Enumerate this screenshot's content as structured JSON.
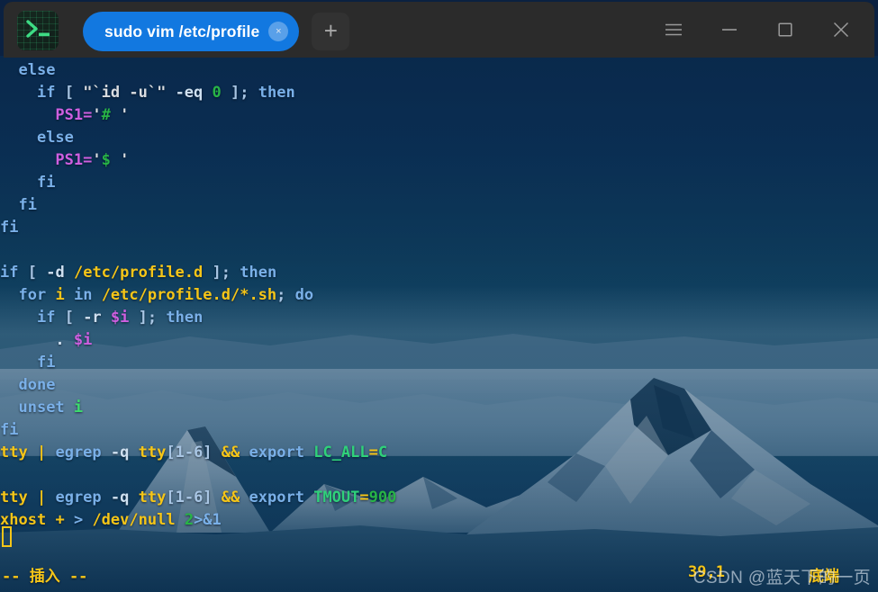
{
  "window": {
    "app_icon_name": "terminal-prompt-icon",
    "tabs": [
      {
        "label": "sudo vim /etc/profile",
        "close_label": "×",
        "active": true
      }
    ],
    "new_tab_label": "+",
    "controls": {
      "menu_name": "hamburger-menu",
      "minimize_name": "minimize",
      "maximize_name": "maximize",
      "close_name": "close"
    },
    "accent_color": "#1278e0",
    "titlebar_color": "#2b2b2b"
  },
  "editor": {
    "lines": [
      [
        {
          "t": "  ",
          "c": "plain"
        },
        {
          "t": "else",
          "c": "kw"
        }
      ],
      [
        {
          "t": "    ",
          "c": "plain"
        },
        {
          "t": "if",
          "c": "kw"
        },
        {
          "t": " ",
          "c": "plain"
        },
        {
          "t": "[",
          "c": "punc"
        },
        {
          "t": " ",
          "c": "plain"
        },
        {
          "t": "\"`id -u`\"",
          "c": "str"
        },
        {
          "t": " ",
          "c": "plain"
        },
        {
          "t": "-eq",
          "c": "plain"
        },
        {
          "t": " ",
          "c": "plain"
        },
        {
          "t": "0",
          "c": "num"
        },
        {
          "t": " ",
          "c": "plain"
        },
        {
          "t": "]",
          "c": "punc"
        },
        {
          "t": ";",
          "c": "punc"
        },
        {
          "t": " ",
          "c": "plain"
        },
        {
          "t": "then",
          "c": "kw"
        }
      ],
      [
        {
          "t": "      ",
          "c": "plain"
        },
        {
          "t": "PS1=",
          "c": "var"
        },
        {
          "t": "'",
          "c": "str"
        },
        {
          "t": "#",
          "c": "num"
        },
        {
          "t": " '",
          "c": "str"
        }
      ],
      [
        {
          "t": "    ",
          "c": "plain"
        },
        {
          "t": "else",
          "c": "kw"
        }
      ],
      [
        {
          "t": "      ",
          "c": "plain"
        },
        {
          "t": "PS1=",
          "c": "var"
        },
        {
          "t": "'",
          "c": "str"
        },
        {
          "t": "$",
          "c": "num"
        },
        {
          "t": " '",
          "c": "str"
        }
      ],
      [
        {
          "t": "    ",
          "c": "plain"
        },
        {
          "t": "fi",
          "c": "kw"
        }
      ],
      [
        {
          "t": "  ",
          "c": "plain"
        },
        {
          "t": "fi",
          "c": "kw"
        }
      ],
      [
        {
          "t": "fi",
          "c": "kw"
        }
      ],
      [
        {
          "t": "",
          "c": "plain"
        }
      ],
      [
        {
          "t": "if",
          "c": "kw"
        },
        {
          "t": " ",
          "c": "plain"
        },
        {
          "t": "[",
          "c": "punc"
        },
        {
          "t": " ",
          "c": "plain"
        },
        {
          "t": "-d",
          "c": "plain"
        },
        {
          "t": " ",
          "c": "plain"
        },
        {
          "t": "/etc/profile.d",
          "c": "path"
        },
        {
          "t": " ",
          "c": "plain"
        },
        {
          "t": "]",
          "c": "punc"
        },
        {
          "t": ";",
          "c": "punc"
        },
        {
          "t": " ",
          "c": "plain"
        },
        {
          "t": "then",
          "c": "kw"
        }
      ],
      [
        {
          "t": "  ",
          "c": "plain"
        },
        {
          "t": "for",
          "c": "kw"
        },
        {
          "t": " ",
          "c": "plain"
        },
        {
          "t": "i",
          "c": "path"
        },
        {
          "t": " ",
          "c": "plain"
        },
        {
          "t": "in",
          "c": "kw"
        },
        {
          "t": " ",
          "c": "plain"
        },
        {
          "t": "/etc/profile.d/*.sh",
          "c": "path"
        },
        {
          "t": ";",
          "c": "punc"
        },
        {
          "t": " ",
          "c": "plain"
        },
        {
          "t": "do",
          "c": "kw"
        }
      ],
      [
        {
          "t": "    ",
          "c": "plain"
        },
        {
          "t": "if",
          "c": "kw"
        },
        {
          "t": " ",
          "c": "plain"
        },
        {
          "t": "[",
          "c": "punc"
        },
        {
          "t": " ",
          "c": "plain"
        },
        {
          "t": "-r",
          "c": "plain"
        },
        {
          "t": " ",
          "c": "plain"
        },
        {
          "t": "$i",
          "c": "var"
        },
        {
          "t": " ",
          "c": "plain"
        },
        {
          "t": "]",
          "c": "punc"
        },
        {
          "t": ";",
          "c": "punc"
        },
        {
          "t": " ",
          "c": "plain"
        },
        {
          "t": "then",
          "c": "kw"
        }
      ],
      [
        {
          "t": "      ",
          "c": "plain"
        },
        {
          "t": ".",
          "c": "plain"
        },
        {
          "t": " ",
          "c": "plain"
        },
        {
          "t": "$i",
          "c": "var"
        }
      ],
      [
        {
          "t": "    ",
          "c": "plain"
        },
        {
          "t": "fi",
          "c": "kw"
        }
      ],
      [
        {
          "t": "  ",
          "c": "plain"
        },
        {
          "t": "done",
          "c": "kw"
        }
      ],
      [
        {
          "t": "  ",
          "c": "plain"
        },
        {
          "t": "unset",
          "c": "kw"
        },
        {
          "t": " ",
          "c": "plain"
        },
        {
          "t": "i",
          "c": "ident"
        }
      ],
      [
        {
          "t": "fi",
          "c": "kw"
        }
      ],
      [
        {
          "t": "tty",
          "c": "path"
        },
        {
          "t": " ",
          "c": "plain"
        },
        {
          "t": "|",
          "c": "path"
        },
        {
          "t": " ",
          "c": "plain"
        },
        {
          "t": "egrep",
          "c": "kw"
        },
        {
          "t": " ",
          "c": "plain"
        },
        {
          "t": "-q",
          "c": "plain"
        },
        {
          "t": " ",
          "c": "plain"
        },
        {
          "t": "tty",
          "c": "path"
        },
        {
          "t": "[1-6]",
          "c": "punc"
        },
        {
          "t": " ",
          "c": "plain"
        },
        {
          "t": "&&",
          "c": "path"
        },
        {
          "t": " ",
          "c": "plain"
        },
        {
          "t": "export",
          "c": "kw"
        },
        {
          "t": " ",
          "c": "plain"
        },
        {
          "t": "LC_ALL",
          "c": "envg"
        },
        {
          "t": "=",
          "c": "path"
        },
        {
          "t": "C",
          "c": "envg"
        }
      ],
      [
        {
          "t": "",
          "c": "plain"
        }
      ],
      [
        {
          "t": "tty",
          "c": "path"
        },
        {
          "t": " ",
          "c": "plain"
        },
        {
          "t": "|",
          "c": "path"
        },
        {
          "t": " ",
          "c": "plain"
        },
        {
          "t": "egrep",
          "c": "kw"
        },
        {
          "t": " ",
          "c": "plain"
        },
        {
          "t": "-q",
          "c": "plain"
        },
        {
          "t": " ",
          "c": "plain"
        },
        {
          "t": "tty",
          "c": "path"
        },
        {
          "t": "[1-6]",
          "c": "punc"
        },
        {
          "t": " ",
          "c": "plain"
        },
        {
          "t": "&&",
          "c": "path"
        },
        {
          "t": " ",
          "c": "plain"
        },
        {
          "t": "export",
          "c": "kw"
        },
        {
          "t": " ",
          "c": "plain"
        },
        {
          "t": "TMOUT",
          "c": "envg"
        },
        {
          "t": "=",
          "c": "path"
        },
        {
          "t": "900",
          "c": "num"
        }
      ],
      [
        {
          "t": "xhost",
          "c": "path"
        },
        {
          "t": " ",
          "c": "plain"
        },
        {
          "t": "+",
          "c": "path"
        },
        {
          "t": " ",
          "c": "plain"
        },
        {
          "t": ">",
          "c": "kw"
        },
        {
          "t": " ",
          "c": "plain"
        },
        {
          "t": "/dev/null",
          "c": "path"
        },
        {
          "t": " ",
          "c": "plain"
        },
        {
          "t": "2",
          "c": "num"
        },
        {
          "t": ">&1",
          "c": "kw"
        }
      ],
      [
        {
          "t": "",
          "c": "plain"
        }
      ]
    ]
  },
  "statusline": {
    "mode": "-- 插入 --",
    "position": "39,1",
    "scroll": "底端",
    "color": "#f5c518"
  },
  "watermark": {
    "text": "CSDN @蓝天下的一页"
  }
}
